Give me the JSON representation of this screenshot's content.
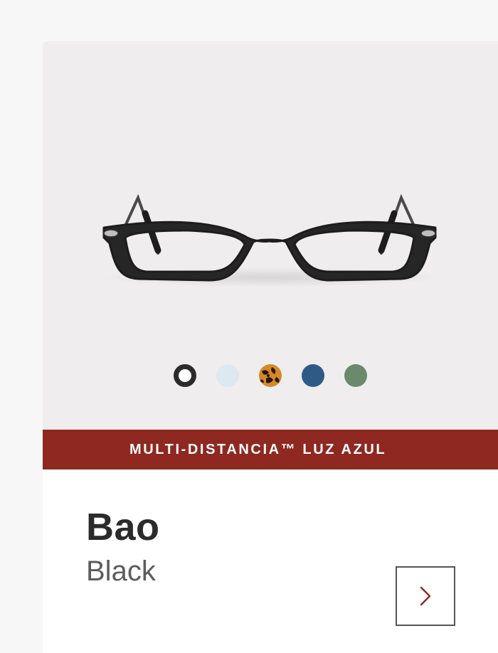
{
  "product": {
    "name": "Bao",
    "color_name": "Black",
    "banner_text": "MULTI-DISTANCIA™ LUZ AZUL",
    "banner_color": "#8e2820",
    "image_background": "#efedee",
    "image_icon": "eyeglasses-frame-icon",
    "next_icon": "chevron-right-icon",
    "next_icon_color": "#8e2820"
  },
  "swatches": [
    {
      "name": "black",
      "color": "#2b2b2b",
      "selected": true
    },
    {
      "name": "light-blue",
      "color": "#dde8f0",
      "selected": false
    },
    {
      "name": "tortoise",
      "color": "#7a3e12",
      "selected": false
    },
    {
      "name": "blue",
      "color": "#2f5a85",
      "selected": false
    },
    {
      "name": "green",
      "color": "#6a8a6b",
      "selected": false
    }
  ]
}
